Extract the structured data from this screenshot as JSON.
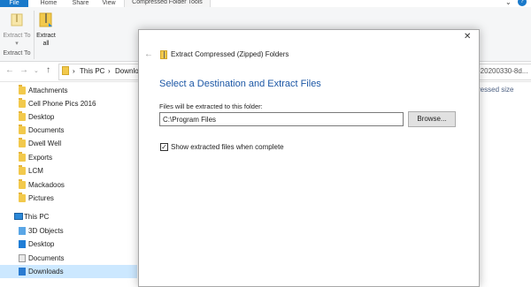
{
  "ribbon": {
    "tabs": {
      "file": "File",
      "home": "Home",
      "share": "Share",
      "view": "View",
      "context": "Compressed Folder Tools"
    },
    "extract_to": "Extract To ▾",
    "extract_all": "Extract all",
    "group_label": "Extract To"
  },
  "address": {
    "crumbs": [
      "This PC",
      "Downlo"
    ],
    "right_text": "-20200330-8d...",
    "column_header": "ressed size"
  },
  "nav_pane": {
    "quick_access": [
      "Attachments",
      "Cell Phone Pics 2016",
      "Desktop",
      "Documents",
      "Dwell Well",
      "Exports",
      "LCM",
      "Mackadoos",
      "Pictures"
    ],
    "this_pc": "This PC",
    "pc_children": [
      "3D Objects",
      "Desktop",
      "Documents",
      "Downloads"
    ]
  },
  "dialog": {
    "title": "Extract Compressed (Zipped) Folders",
    "heading": "Select a Destination and Extract Files",
    "field_label": "Files will be extracted to this folder:",
    "path_value": "C:\\Program Files",
    "browse_label": "Browse...",
    "checkbox_label": "Show extracted files when complete",
    "checkbox_checked": true
  },
  "colors": {
    "accent": "#1979ca",
    "heading": "#1c57a5",
    "selection": "#cce8ff"
  }
}
